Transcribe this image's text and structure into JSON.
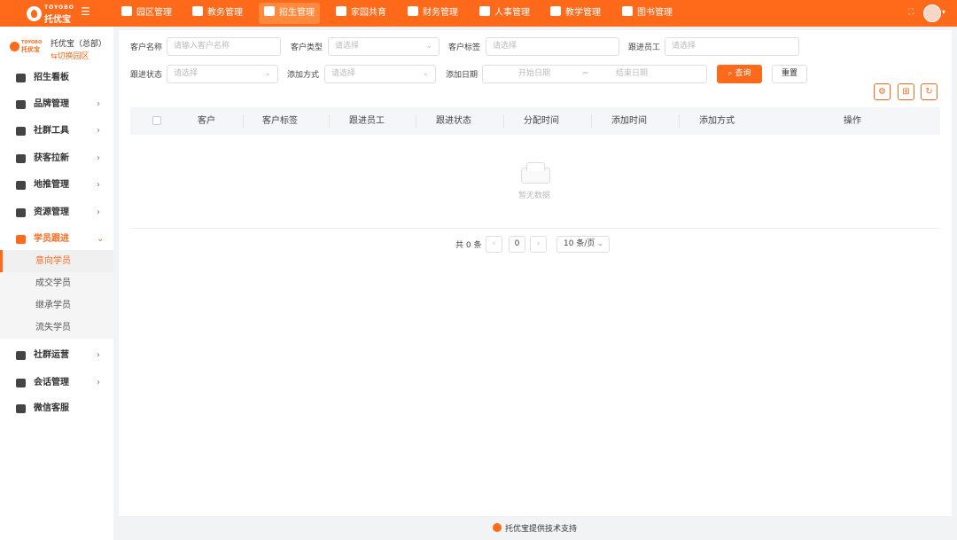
{
  "topbar": {
    "logo_en": "TOYOBO",
    "logo_cn": "托优宝",
    "collapse_icon": "menu-fold-icon",
    "nav": [
      {
        "label": "园区管理",
        "icon": "campus-icon"
      },
      {
        "label": "教务管理",
        "icon": "academic-icon"
      },
      {
        "label": "招生管理",
        "icon": "enrollment-icon"
      },
      {
        "label": "家园共育",
        "icon": "home-school-icon"
      },
      {
        "label": "财务管理",
        "icon": "finance-icon"
      },
      {
        "label": "人事管理",
        "icon": "hr-icon"
      },
      {
        "label": "教学管理",
        "icon": "teaching-icon"
      },
      {
        "label": "图书管理",
        "icon": "library-icon"
      }
    ],
    "active_nav": "招生管理",
    "expand_icon": "fullscreen-icon",
    "avatar_icon": "user-avatar-icon"
  },
  "sidebar": {
    "org_logo_en": "TOYOBO",
    "org_logo_cn": "托优宝",
    "org_name": "托优宝（总部）",
    "switch_label": "切换园区",
    "menu": [
      {
        "label": "招生看板",
        "icon": "dashboard-icon",
        "has_arrow": false
      },
      {
        "label": "品牌管理",
        "icon": "brand-icon",
        "has_arrow": true
      },
      {
        "label": "社群工具",
        "icon": "community-icon",
        "has_arrow": true
      },
      {
        "label": "获客拉新",
        "icon": "acquire-icon",
        "has_arrow": true
      },
      {
        "label": "地推管理",
        "icon": "promotion-icon",
        "has_arrow": true
      },
      {
        "label": "资源管理",
        "icon": "resource-icon",
        "has_arrow": true
      },
      {
        "label": "学员跟进",
        "icon": "student-follow-icon",
        "has_arrow": true,
        "open": true
      },
      {
        "label": "社群运营",
        "icon": "community-ops-icon",
        "has_arrow": true
      },
      {
        "label": "会话管理",
        "icon": "chat-icon",
        "has_arrow": true
      },
      {
        "label": "微信客服",
        "icon": "wechat-service-icon",
        "has_arrow": false
      }
    ],
    "submenu": [
      {
        "label": "意向学员",
        "active": true
      },
      {
        "label": "成交学员"
      },
      {
        "label": "继承学员"
      },
      {
        "label": "流失学员"
      }
    ]
  },
  "filters": {
    "customer_name": {
      "label": "客户名称",
      "placeholder": "请输入客户名称"
    },
    "customer_type": {
      "label": "客户类型",
      "placeholder": "请选择"
    },
    "customer_tag": {
      "label": "客户标签",
      "placeholder": "请选择"
    },
    "follow_staff": {
      "label": "跟进员工",
      "placeholder": "请选择"
    },
    "follow_status": {
      "label": "跟进状态",
      "placeholder": "请选择"
    },
    "add_method": {
      "label": "添加方式",
      "placeholder": "请选择"
    },
    "add_date": {
      "label": "添加日期",
      "start": "开始日期",
      "separator": "~",
      "end": "结束日期"
    },
    "query_label": "查询",
    "reset_label": "重置"
  },
  "toolbar": {
    "settings_icon": "settings-icon",
    "columns_icon": "grid-icon",
    "refresh_icon": "refresh-icon"
  },
  "table": {
    "columns": [
      "客户",
      "客户标签",
      "跟进员工",
      "跟进状态",
      "分配时间",
      "添加时间",
      "添加方式",
      "操作"
    ],
    "rows": [],
    "empty_text": "暂无数据"
  },
  "pagination": {
    "total": "共 0 条",
    "current_page": "0",
    "page_size": "10 条/页"
  },
  "footer": {
    "text": "托优宝提供技术支持"
  }
}
